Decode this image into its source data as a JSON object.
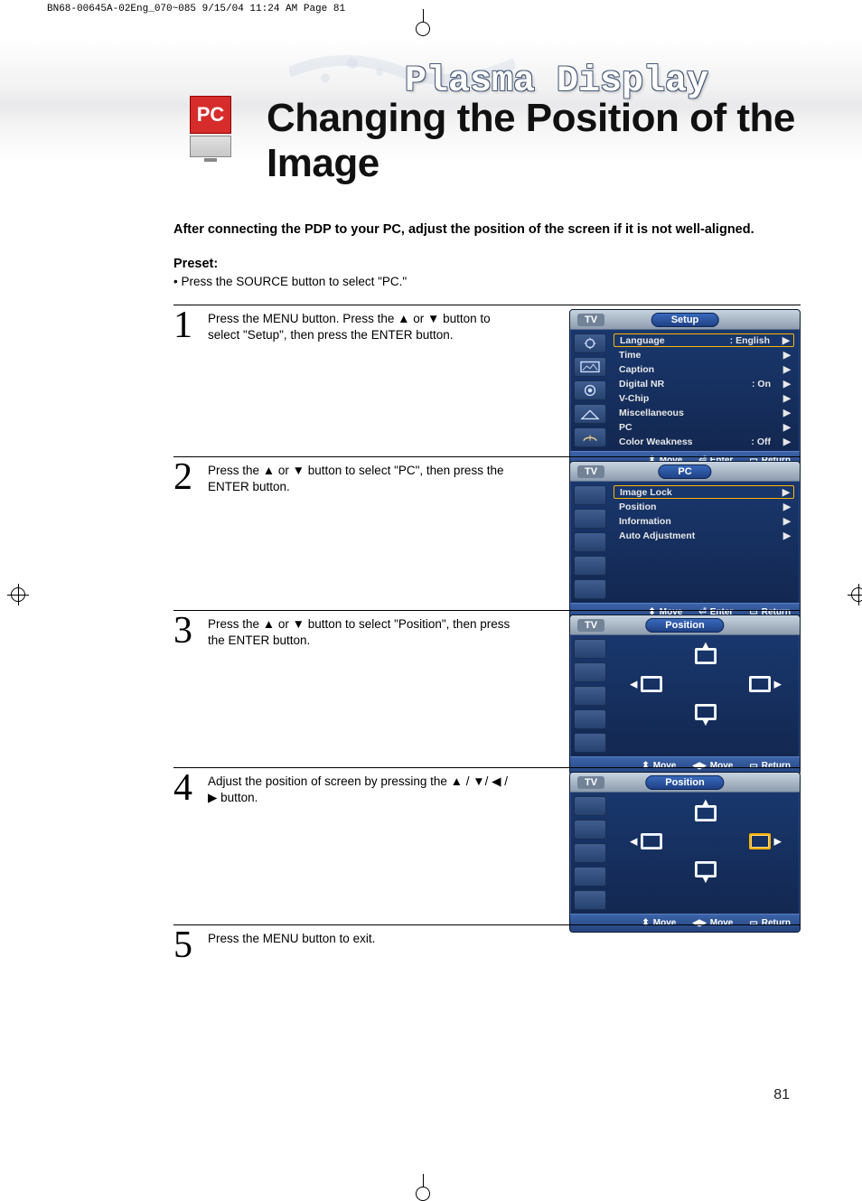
{
  "print_header": "BN68-00645A-02Eng_070~085  9/15/04  11:24 AM  Page 81",
  "pc_badge": "PC",
  "plasma": "Plasma Display",
  "title": "Changing the Position of the Image",
  "intro": "After connecting the PDP to your PC, adjust the position of the screen if it is not well-aligned.",
  "preset_label": "Preset:",
  "preset_text": "Press the SOURCE button to select \"PC.\"",
  "steps": {
    "s1": {
      "num": "1",
      "text": "Press the MENU button. Press the ▲ or ▼ button to select \"Setup\", then press the ENTER button."
    },
    "s2": {
      "num": "2",
      "text": "Press the ▲ or ▼ button to select \"PC\", then press the ENTER button."
    },
    "s3": {
      "num": "3",
      "text": "Press the ▲ or ▼ button to select \"Position\", then press the ENTER button."
    },
    "s4": {
      "num": "4",
      "text": "Adjust the position of screen by pressing the ▲ / ▼/ ◀ / ▶ button."
    },
    "s5": {
      "num": "5",
      "text": "Press the MENU button to exit."
    }
  },
  "osd": {
    "tv": "TV",
    "foot_move": "Move",
    "foot_enter": "Enter",
    "foot_return": "Return",
    "arrow": "▶"
  },
  "osd1": {
    "title": "Setup",
    "rows": {
      "r0": {
        "label": "Language",
        "val": ":  English"
      },
      "r1": {
        "label": "Time",
        "val": ""
      },
      "r2": {
        "label": "Caption",
        "val": ""
      },
      "r3": {
        "label": "Digital NR",
        "val": ":  On"
      },
      "r4": {
        "label": "V-Chip",
        "val": ""
      },
      "r5": {
        "label": "Miscellaneous",
        "val": ""
      },
      "r6": {
        "label": "PC",
        "val": ""
      },
      "r7": {
        "label": "Color Weakness",
        "val": ":  Off"
      }
    }
  },
  "osd2": {
    "title": "PC",
    "rows": {
      "r0": {
        "label": "Image Lock",
        "val": ""
      },
      "r1": {
        "label": "Position",
        "val": ""
      },
      "r2": {
        "label": "Information",
        "val": ""
      },
      "r3": {
        "label": "Auto Adjustment",
        "val": ""
      }
    }
  },
  "osd3": {
    "title": "Position"
  },
  "osd4": {
    "title": "Position",
    "foot_move2": "Move"
  },
  "page_number": "81"
}
